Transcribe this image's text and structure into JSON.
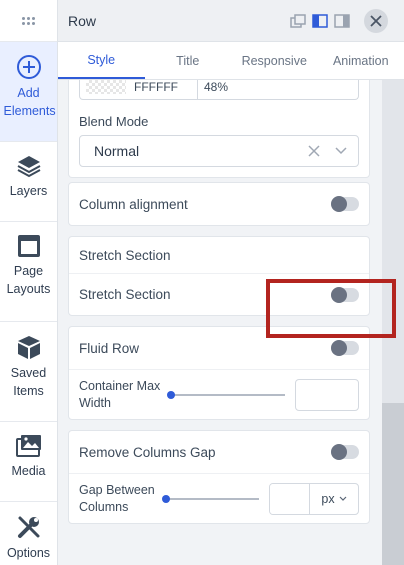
{
  "rail": {
    "items": [
      {
        "label": "Add Elements",
        "icon": "plus-circle-icon"
      },
      {
        "label": "Layers",
        "icon": "layers-icon"
      },
      {
        "label": "Page Layouts",
        "icon": "layout-icon"
      },
      {
        "label": "Saved Items",
        "icon": "cube-icon"
      },
      {
        "label": "Media",
        "icon": "media-icon"
      },
      {
        "label": "Options",
        "icon": "wrench-icon"
      }
    ]
  },
  "header": {
    "title": "Row"
  },
  "tabs": [
    "Style",
    "Title",
    "Responsive",
    "Animation"
  ],
  "color_field": {
    "hex": "FFFFFF",
    "opacity": "48%"
  },
  "blend": {
    "label": "Blend Mode",
    "value": "Normal"
  },
  "column_alignment": {
    "label": "Column alignment"
  },
  "stretch": {
    "header": "Stretch Section",
    "toggle_label": "Stretch Section"
  },
  "fluid": {
    "label": "Fluid Row",
    "container_label_1": "Container Max",
    "container_label_2": "Width",
    "container_value": ""
  },
  "gap": {
    "label": "Remove Columns Gap",
    "between_label_1": "Gap Between",
    "between_label_2": "Columns",
    "value": "",
    "unit": "px"
  },
  "colors": {
    "accent": "#2f5bd8",
    "highlight": "#b3241f"
  }
}
